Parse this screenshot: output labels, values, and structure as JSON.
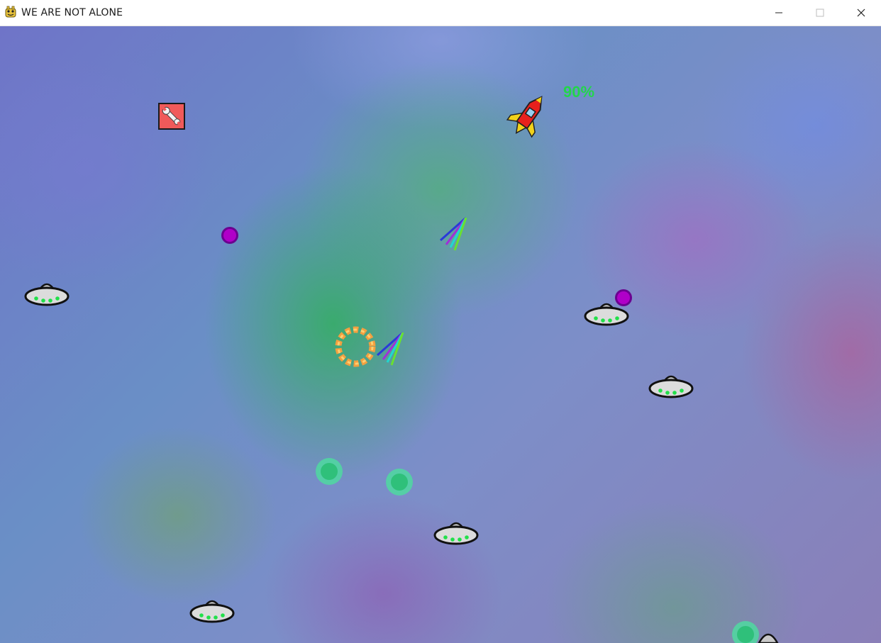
{
  "window": {
    "title": "WE ARE NOT ALONE",
    "app_icon": "pygame-snake-icon",
    "controls": [
      "minimize-icon",
      "maximize-icon",
      "close-icon"
    ]
  },
  "hud": {
    "health_percent": "90%",
    "health_value": 0.9,
    "text_color": "#22d64a"
  },
  "sprites": {
    "player_ship": "rocket",
    "ufo_count": 6,
    "powerup": "wrench-repair-crate",
    "orbs_purple": 2,
    "orbs_green": 3,
    "shots_rainbow": 2,
    "explosion": "orange-ring"
  },
  "colors": {
    "ufo_lights": "#22e04a",
    "purple_orb": "#b000c8",
    "green_orb": "#35d08a",
    "crate": "#f05050"
  }
}
